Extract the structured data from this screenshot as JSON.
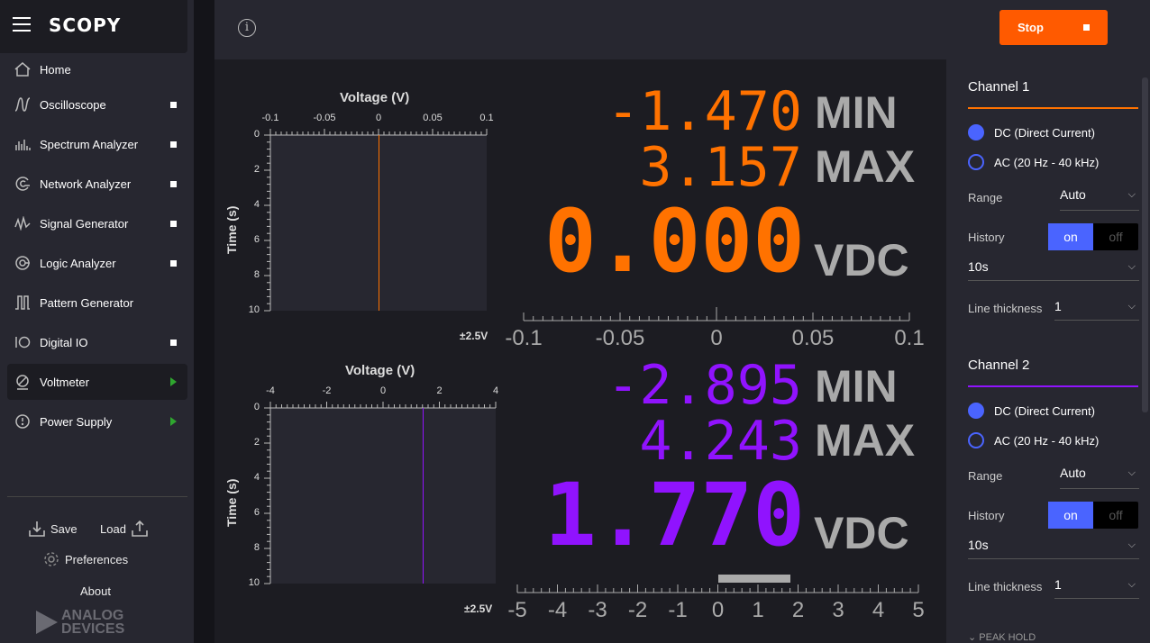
{
  "app": {
    "name": "SCOPY"
  },
  "sidebar": {
    "items": [
      {
        "label": "Home",
        "icon": "home-icon",
        "indicator": "none"
      },
      {
        "label": "Oscilloscope",
        "icon": "oscilloscope-icon",
        "indicator": "square"
      },
      {
        "label": "Spectrum Analyzer",
        "icon": "spectrum-icon",
        "indicator": "square"
      },
      {
        "label": "Network Analyzer",
        "icon": "network-icon",
        "indicator": "square"
      },
      {
        "label": "Signal Generator",
        "icon": "signal-icon",
        "indicator": "square"
      },
      {
        "label": "Logic Analyzer",
        "icon": "logic-icon",
        "indicator": "square"
      },
      {
        "label": "Pattern Generator",
        "icon": "pattern-icon",
        "indicator": "none"
      },
      {
        "label": "Digital IO",
        "icon": "digital-io-icon",
        "indicator": "square"
      },
      {
        "label": "Voltmeter",
        "icon": "voltmeter-icon",
        "indicator": "play"
      },
      {
        "label": "Power Supply",
        "icon": "power-icon",
        "indicator": "play"
      }
    ],
    "save_label": "Save",
    "load_label": "Load",
    "preferences_label": "Preferences",
    "about_label": "About",
    "brand_line1": "ANALOG",
    "brand_line2": "DEVICES"
  },
  "topbar": {
    "info_icon": "info-icon",
    "stop_label": "Stop"
  },
  "channels": [
    {
      "color": "#ff7200",
      "min_value": "-1.470",
      "max_value": "3.157",
      "value": "0.000",
      "min_label": "MIN",
      "max_label": "MAX",
      "unit": "VDC",
      "history_title": "Voltage (V)",
      "history_xticks": [
        "-0.1",
        "-0.05",
        "0",
        "0.05",
        "0.1"
      ],
      "history_yticks": [
        "0",
        "2",
        "4",
        "6",
        "8",
        "10"
      ],
      "history_ytitle": "Time (s)",
      "range_label": "±2.5V",
      "scale_ticks": [
        "-0.1",
        "-0.05",
        "0",
        "0.05",
        "0.1"
      ]
    },
    {
      "color": "#9013fe",
      "min_value": "-2.895",
      "max_value": "4.243",
      "value": "1.770",
      "min_label": "MIN",
      "max_label": "MAX",
      "unit": "VDC",
      "history_title": "Voltage (V)",
      "history_xticks": [
        "-4",
        "-2",
        "0",
        "2",
        "4"
      ],
      "history_yticks": [
        "0",
        "2",
        "4",
        "6",
        "8",
        "10"
      ],
      "history_ytitle": "Time (s)",
      "range_label": "±2.5V",
      "scale_ticks": [
        "-5",
        "-4",
        "-3",
        "-2",
        "-1",
        "0",
        "1",
        "2",
        "3",
        "4",
        "5"
      ]
    }
  ],
  "panel": {
    "channels": [
      {
        "title": "Channel 1",
        "color": "#ff7200",
        "dc_label": "DC (Direct Current)",
        "ac_label": "AC (20 Hz - 40 kHz)",
        "range_label": "Range",
        "range_value": "Auto",
        "history_label": "History",
        "on_label": "on",
        "off_label": "off",
        "history_value": "10s",
        "thickness_label": "Line thickness",
        "thickness_value": "1"
      },
      {
        "title": "Channel 2",
        "color": "#9013fe",
        "dc_label": "DC (Direct Current)",
        "ac_label": "AC (20 Hz - 40 kHz)",
        "range_label": "Range",
        "range_value": "Auto",
        "history_label": "History",
        "on_label": "on",
        "off_label": "off",
        "history_value": "10s",
        "thickness_label": "Line thickness",
        "thickness_value": "1"
      }
    ],
    "peak_hold_label": "PEAK HOLD"
  }
}
